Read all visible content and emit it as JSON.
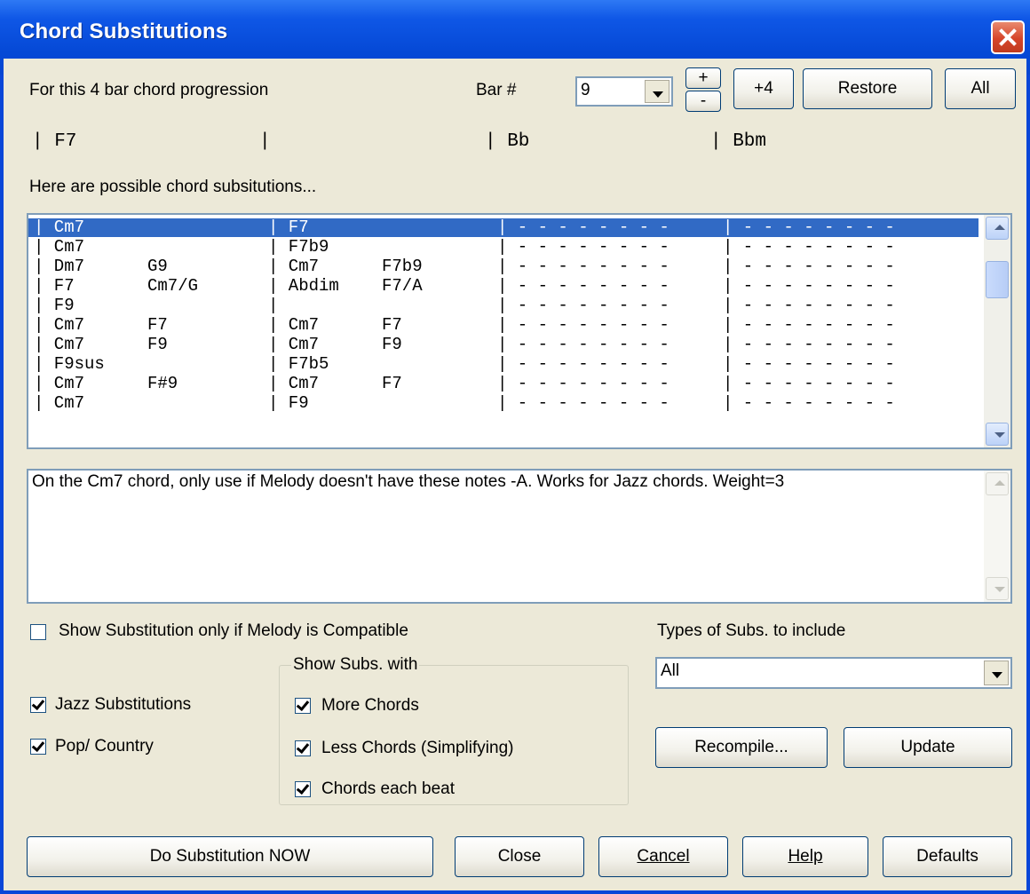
{
  "window": {
    "title": "Chord Substitutions"
  },
  "top": {
    "progression_label": "For this 4 bar chord progression",
    "bar_label": "Bar #",
    "bar_value": "9",
    "plus_label": "+",
    "minus_label": "-",
    "plus4_label": "+4",
    "restore_label": "Restore",
    "all_label": "All"
  },
  "progression": {
    "bars": [
      "| F7",
      "|",
      "| Bb",
      "| Bbm"
    ]
  },
  "subs_intro": "Here are possible chord subsitutions...",
  "subs_list": {
    "selected_index": 0,
    "rows": [
      [
        "| Cm7",
        "",
        "| F7",
        "",
        "| - - - - - - - -",
        "| - - - - - - - -"
      ],
      [
        "| Cm7",
        "",
        "| F7b9",
        "",
        "| - - - - - - - -",
        "| - - - - - - - -"
      ],
      [
        "| Dm7",
        "G9",
        "| Cm7",
        "F7b9",
        "| - - - - - - - -",
        "| - - - - - - - -"
      ],
      [
        "| F7",
        "Cm7/G",
        "| Abdim",
        "F7/A",
        "| - - - - - - - -",
        "| - - - - - - - -"
      ],
      [
        "| F9",
        "",
        "|",
        "",
        "| - - - - - - - -",
        "| - - - - - - - -"
      ],
      [
        "| Cm7",
        "F7",
        "| Cm7",
        "F7",
        "| - - - - - - - -",
        "| - - - - - - - -"
      ],
      [
        "| Cm7",
        "F9",
        "| Cm7",
        "F9",
        "| - - - - - - - -",
        "| - - - - - - - -"
      ],
      [
        "| F9sus",
        "",
        "| F7b5",
        "",
        "| - - - - - - - -",
        "| - - - - - - - -"
      ],
      [
        "| Cm7",
        "F#9",
        "| Cm7",
        "F7",
        "| - - - - - - - -",
        "| - - - - - - - -"
      ],
      [
        "| Cm7",
        "",
        "| F9",
        "",
        "| - - - - - - - -",
        "| - - - - - - - -"
      ]
    ]
  },
  "description": "On the Cm7 chord, only use if Melody doesn't have these notes -A. Works for Jazz chords. Weight=3",
  "options": {
    "melody_compatible_label": "Show Substitution only if Melody is Compatible",
    "melody_compatible_checked": false,
    "jazz_label": "Jazz Substitutions",
    "jazz_checked": true,
    "pop_label": "Pop/ Country",
    "pop_checked": true,
    "show_subs_group_label": "Show Subs. with",
    "more_chords_label": "More Chords",
    "less_chords_label": "Less Chords (Simplifying)",
    "each_beat_label": "Chords each beat",
    "types_label": "Types of Subs. to include",
    "types_value": "All",
    "recompile_label": "Recompile...",
    "update_label": "Update"
  },
  "footer": {
    "do_sub_label": "Do Substitution NOW",
    "close_label": "Close",
    "cancel_label": "Cancel",
    "help_label": "Help",
    "defaults_label": "Defaults"
  }
}
